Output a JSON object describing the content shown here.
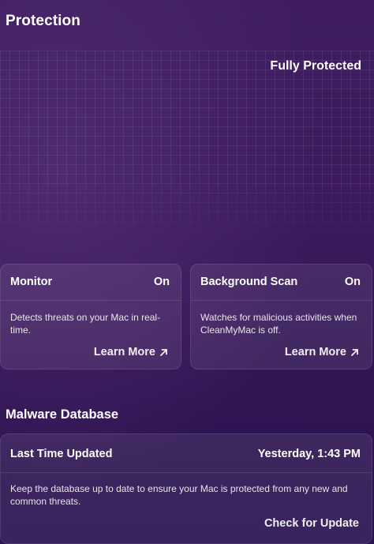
{
  "page": {
    "title": "Protection",
    "status": "Fully Protected"
  },
  "cards": {
    "monitor": {
      "title": "Monitor",
      "state": "On",
      "description": "Detects threats on your Mac in real-time.",
      "link_label": "Learn More",
      "link_icon": "arrow-up-right-icon"
    },
    "background_scan": {
      "title": "Background Scan",
      "state": "On",
      "description": "Watches for malicious activities when CleanMyMac is off.",
      "link_label": "Learn More",
      "link_icon": "arrow-up-right-icon"
    }
  },
  "malware_database": {
    "section_title": "Malware Database",
    "row_label": "Last Time Updated",
    "row_value": "Yesterday, 1:43 PM",
    "description": "Keep the database up to date to ensure your Mac is protected from any new and common threats.",
    "action_label": "Check for Update"
  },
  "colors": {
    "background_top": "#3f1d60",
    "background_bottom": "#2a1250",
    "text": "#ffffff"
  }
}
